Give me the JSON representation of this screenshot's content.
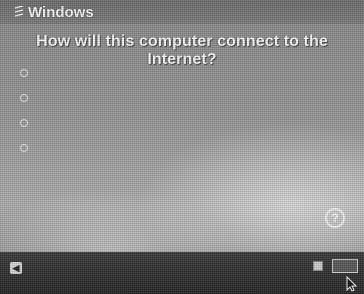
{
  "window": {
    "logo_text": "Windows",
    "icon": "windows-flag-icon"
  },
  "page": {
    "heading": "How will this computer connect to the Internet?"
  },
  "options": [
    {
      "label": ""
    },
    {
      "label": ""
    },
    {
      "label": ""
    },
    {
      "label": ""
    }
  ],
  "footer": {
    "back_label": "",
    "skip_label": "",
    "next_label": "",
    "help_symbol": "?"
  },
  "colors": {
    "heading_text": "#ffffff",
    "footer_bg": "#262626"
  }
}
